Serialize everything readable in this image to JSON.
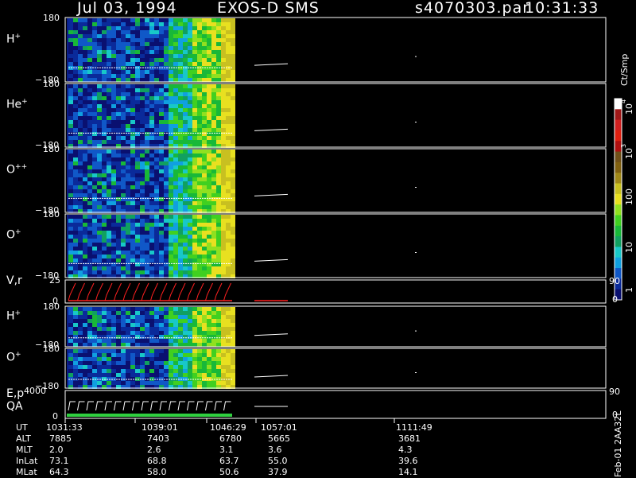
{
  "header": {
    "date": "Jul 03, 1994",
    "instrument": "EXOS-D SMS",
    "file": "s4070303.par",
    "time": "10:31:33"
  },
  "colors": {
    "background": "#000000",
    "frame": "#ffffff",
    "cold": "#0a1e8c",
    "velocity_trace": "#ff2020",
    "qa_bar": "#30d040"
  },
  "colorbar": {
    "unit": "Ct/Smp",
    "tick_labels": [
      "1",
      "10",
      "100",
      "10",
      "3",
      "10",
      "4"
    ],
    "stops": [
      "#0a1070",
      "#0a2a9a",
      "#1058c8",
      "#10a0e0",
      "#18c8c8",
      "#10a060",
      "#18b838",
      "#40d020",
      "#90e020",
      "#e8e020",
      "#c8c020",
      "#a08818",
      "#806010",
      "#705018",
      "#b01010",
      "#e02010",
      "#d02020",
      "#a01818",
      "#ffffff"
    ]
  },
  "panels": [
    {
      "label": "H",
      "sup": "+",
      "ymax": "180",
      "ymin": "−180"
    },
    {
      "label": "He",
      "sup": "+",
      "ymax": "180",
      "ymin": "−180"
    },
    {
      "label": "O",
      "sup": "++",
      "ymax": "180",
      "ymin": "−180"
    },
    {
      "label": "O",
      "sup": "+",
      "ymax": "180",
      "ymin": "−180"
    },
    {
      "label": "V,r",
      "sup": "",
      "ymax": "25",
      "ymin": "0",
      "rmax": "90",
      "rmin": "0"
    },
    {
      "label": "H",
      "sup": "+",
      "ymax": "180",
      "ymin": "−180"
    },
    {
      "label": "O",
      "sup": "+",
      "ymax": "180",
      "ymin": "−180"
    },
    {
      "label": "E,p",
      "sup": "",
      "label2": "QA",
      "ymax": "4000",
      "ymin": "0",
      "rmax": "90",
      "rmin": "0"
    }
  ],
  "footer": {
    "rows": [
      {
        "name": "UT",
        "values": [
          "1031:33",
          "1039:01",
          "1046:29",
          "1057:01",
          "1111:49"
        ]
      },
      {
        "name": "ALT",
        "values": [
          "7885",
          "7403",
          "6780",
          "5665",
          "3681"
        ]
      },
      {
        "name": "MLT",
        "values": [
          "2.0",
          "2.6",
          "3.1",
          "3.6",
          "4.3"
        ]
      },
      {
        "name": "InLat",
        "values": [
          "73.1",
          "68.8",
          "63.7",
          "55.0",
          "39.6"
        ]
      },
      {
        "name": "MLat",
        "values": [
          "64.3",
          "58.0",
          "50.6",
          "37.9",
          "14.1"
        ]
      }
    ],
    "side_note": "Feb-01 2AA32L"
  },
  "chart_data": {
    "type": "heatmap",
    "title": "Jul 03, 1994 EXOS-D SMS",
    "x_tick_labels": [
      "1031:33",
      "1039:01",
      "1046:29",
      "1057:01",
      "1111:49"
    ],
    "colorbar_unit": "Ct/Smp",
    "colorbar_ticks": [
      "1",
      "10",
      "100",
      "10",
      "3",
      "10",
      "4"
    ],
    "panels": [
      {
        "label": "H+",
        "y_range": [
          -180,
          180
        ]
      },
      {
        "label": "He+",
        "y_range": [
          -180,
          180
        ]
      },
      {
        "label": "O++",
        "y_range": [
          -180,
          180
        ]
      },
      {
        "label": "O+",
        "y_range": [
          -180,
          180
        ]
      },
      {
        "label": "V,r",
        "y_range": [
          0,
          25
        ],
        "right_range": [
          0,
          90
        ]
      },
      {
        "label": "H+",
        "y_range": [
          -180,
          180
        ]
      },
      {
        "label": "O+",
        "y_range": [
          -180,
          180
        ]
      },
      {
        "label": "E,p QA",
        "y_range": [
          0,
          4000
        ],
        "right_range": [
          0,
          90
        ]
      }
    ]
  }
}
